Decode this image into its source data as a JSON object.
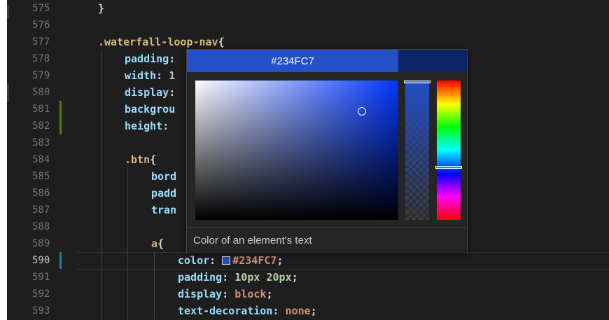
{
  "editor": {
    "lines": [
      {
        "num": "575",
        "tokens": [
          {
            "t": "}",
            "c": "k-punc"
          }
        ],
        "indent": 140
      },
      {
        "num": "576",
        "tokens": [],
        "indent": 140
      },
      {
        "num": "577",
        "tokens": [
          {
            "t": ".waterfall-loop-nav",
            "c": "k-sel"
          },
          {
            "t": "{",
            "c": "k-punc"
          }
        ],
        "indent": 140
      },
      {
        "num": "578",
        "tokens": [
          {
            "t": "padding",
            "c": "k-prop"
          },
          {
            "t": ":",
            "c": "k-punc"
          }
        ],
        "indent": 178
      },
      {
        "num": "579",
        "tokens": [
          {
            "t": "width",
            "c": "k-prop"
          },
          {
            "t": ": ",
            "c": "k-punc"
          },
          {
            "t": "1",
            "c": "k-num"
          }
        ],
        "indent": 178
      },
      {
        "num": "580",
        "tokens": [
          {
            "t": "display",
            "c": "k-prop"
          },
          {
            "t": ":",
            "c": "k-punc"
          }
        ],
        "indent": 178
      },
      {
        "num": "581",
        "tokens": [
          {
            "t": "backgrou",
            "c": "k-prop"
          }
        ],
        "indent": 178
      },
      {
        "num": "582",
        "tokens": [
          {
            "t": "height",
            "c": "k-prop"
          },
          {
            "t": ":",
            "c": "k-punc"
          }
        ],
        "indent": 178
      },
      {
        "num": "583",
        "tokens": [],
        "indent": 178
      },
      {
        "num": "584",
        "tokens": [
          {
            "t": ".btn",
            "c": "k-sel"
          },
          {
            "t": "{",
            "c": "k-punc"
          }
        ],
        "indent": 178
      },
      {
        "num": "585",
        "tokens": [
          {
            "t": "bord",
            "c": "k-prop"
          }
        ],
        "indent": 216
      },
      {
        "num": "586",
        "tokens": [
          {
            "t": "padd",
            "c": "k-prop"
          }
        ],
        "indent": 216
      },
      {
        "num": "587",
        "tokens": [
          {
            "t": "tran",
            "c": "k-prop"
          }
        ],
        "indent": 216
      },
      {
        "num": "588",
        "tokens": [],
        "indent": 216
      },
      {
        "num": "589",
        "tokens": [
          {
            "t": "a",
            "c": "k-sel"
          },
          {
            "t": "{",
            "c": "k-punc"
          }
        ],
        "indent": 216
      },
      {
        "num": "590",
        "tokens": [
          {
            "t": "color",
            "c": "k-prop"
          },
          {
            "t": ": ",
            "c": "k-punc"
          },
          {
            "t": "SWATCH",
            "c": "swatch"
          },
          {
            "t": "#234FC7",
            "c": "k-str"
          },
          {
            "t": ";",
            "c": "k-punc"
          }
        ],
        "indent": 254,
        "active": true
      },
      {
        "num": "591",
        "tokens": [
          {
            "t": "padding",
            "c": "k-prop"
          },
          {
            "t": ": ",
            "c": "k-punc"
          },
          {
            "t": "10px 20px",
            "c": "k-num"
          },
          {
            "t": ";",
            "c": "k-punc"
          }
        ],
        "indent": 254
      },
      {
        "num": "592",
        "tokens": [
          {
            "t": "display",
            "c": "k-prop"
          },
          {
            "t": ": ",
            "c": "k-punc"
          },
          {
            "t": "block",
            "c": "k-str"
          },
          {
            "t": ";",
            "c": "k-punc"
          }
        ],
        "indent": 254
      },
      {
        "num": "593",
        "tokens": [
          {
            "t": "text-decoration",
            "c": "k-prop"
          },
          {
            "t": ": ",
            "c": "k-punc"
          },
          {
            "t": "none",
            "c": "k-str"
          },
          {
            "t": ";",
            "c": "k-punc"
          }
        ],
        "indent": 254
      }
    ]
  },
  "color_picker": {
    "hex_value": "#234FC7",
    "selected_color": "#234FC7",
    "original_color": "#0e2468",
    "hue_color": "#0036ff",
    "saturation": 0.82,
    "brightness": 0.78,
    "opacity": 1.0,
    "hue_degrees": 224,
    "hover_text": "Color of an element's text"
  },
  "colors": {
    "git_added": "#587c0c",
    "git_modified": "#1b81a8"
  }
}
